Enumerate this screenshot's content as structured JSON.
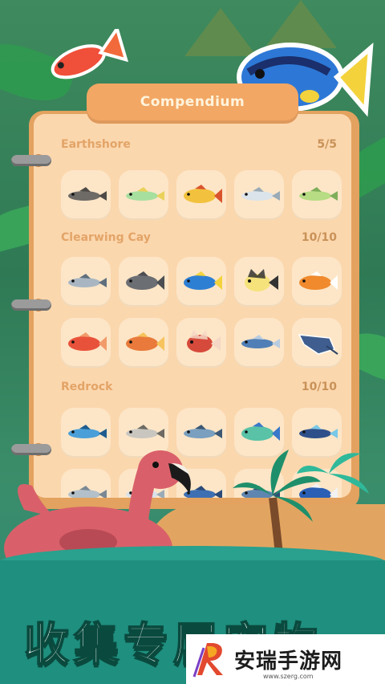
{
  "compendium": {
    "title": "Compendium",
    "sections": [
      {
        "name": "Earthshore",
        "count": "5/5",
        "fish": [
          {
            "name": "catfish",
            "body": "#6e6a66",
            "fin": "#4d4a47"
          },
          {
            "name": "green-striped-fish",
            "body": "#a7df9f",
            "fin": "#e9d15a"
          },
          {
            "name": "yellow-grouper",
            "body": "#f2c23e",
            "fin": "#d9542d"
          },
          {
            "name": "silver-needlefish",
            "body": "#dbe4ea",
            "fin": "#9aaab6"
          },
          {
            "name": "green-pike",
            "body": "#b7dc84",
            "fin": "#7fae5a"
          }
        ]
      },
      {
        "name": "Clearwing Cay",
        "count": "10/10",
        "fish": [
          {
            "name": "barracuda",
            "body": "#a9b6c2",
            "fin": "#5f6f7d"
          },
          {
            "name": "grey-grouper",
            "body": "#6b6e73",
            "fin": "#4b4e52"
          },
          {
            "name": "blue-tang",
            "body": "#2d7fd3",
            "fin": "#f3d23c"
          },
          {
            "name": "moorish-idol",
            "body": "#f5e27a",
            "fin": "#333333"
          },
          {
            "name": "clownfish",
            "body": "#f08a2d",
            "fin": "#ffffff"
          },
          {
            "name": "red-snapper",
            "body": "#e9523a",
            "fin": "#f29a6a"
          },
          {
            "name": "hogfish",
            "body": "#e97a3b",
            "fin": "#f6c35c"
          },
          {
            "name": "lionfish",
            "body": "#d64a3b",
            "fin": "#f4d7c5"
          },
          {
            "name": "mackerel",
            "body": "#4f7fb6",
            "fin": "#b9ccdf"
          },
          {
            "name": "stingray",
            "body": "#3f5e8f",
            "fin": "#2c4468"
          }
        ]
      },
      {
        "name": "Redrock",
        "count": "10/10",
        "fish": [
          {
            "name": "blue-runner",
            "body": "#4a9fd8",
            "fin": "#1d5c8f"
          },
          {
            "name": "wahoo",
            "body": "#c9c6c0",
            "fin": "#6d6963"
          },
          {
            "name": "tuna",
            "body": "#7a9fbf",
            "fin": "#3c5874"
          },
          {
            "name": "mahi-mahi",
            "body": "#59c2a7",
            "fin": "#3a78c9"
          },
          {
            "name": "blue-spotted-goby",
            "body": "#2f4f8a",
            "fin": "#79c8e6"
          },
          {
            "name": "shark",
            "body": "#b3c0c9",
            "fin": "#7a8894"
          },
          {
            "name": "silver-fish",
            "body": "#d8e2ea",
            "fin": "#9aabb8"
          },
          {
            "name": "sailfish",
            "body": "#3e6fb2",
            "fin": "#2a4a7a"
          },
          {
            "name": "bonito",
            "body": "#5e86b0",
            "fin": "#2f4f75"
          },
          {
            "name": "blue-wrasse",
            "body": "#2a5fb5",
            "fin": "#f2f2f2"
          }
        ]
      }
    ]
  },
  "banner": {
    "text": "收集专属宠物"
  },
  "watermark": {
    "text": "安瑞手游网",
    "url": "www.szerg.com"
  },
  "colors": {
    "page": "#fbd7ae",
    "cell": "#fde6c7",
    "tab": "#f2a764",
    "section_label": "#e3a467"
  }
}
